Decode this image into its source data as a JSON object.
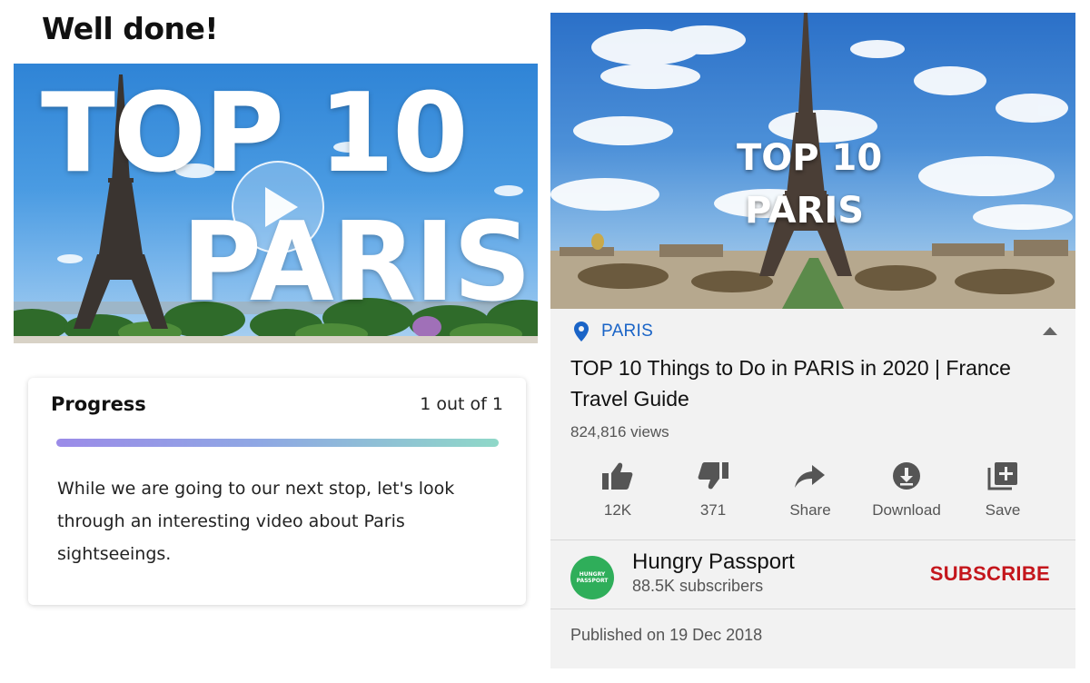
{
  "left": {
    "heading": "Well done!",
    "thumbnail": {
      "line1": "TOP 10",
      "line2": "PARIS",
      "play_icon": "play-icon"
    },
    "progress_card": {
      "title": "Progress",
      "count": "1 out of 1",
      "progress_fraction": 1.0,
      "description": "While we are going to our next stop, let's look through an interesting video about Paris sightseeings."
    }
  },
  "right": {
    "thumbnail": {
      "line1": "TOP 10",
      "line2": "PARIS"
    },
    "location": {
      "icon": "location-pin-icon",
      "label": "PARIS"
    },
    "video_title": "TOP 10 Things to Do in PARIS in 2020 | France Travel Guide",
    "views": "824,816 views",
    "actions": [
      {
        "icon": "thumbs-up-icon",
        "label": "12K"
      },
      {
        "icon": "thumbs-down-icon",
        "label": "371"
      },
      {
        "icon": "share-icon",
        "label": "Share"
      },
      {
        "icon": "download-icon",
        "label": "Download"
      },
      {
        "icon": "save-playlist-icon",
        "label": "Save"
      }
    ],
    "channel": {
      "avatar_text_1": "HUNGRY",
      "avatar_text_2": "PASSPORT",
      "name": "Hungry Passport",
      "subscribers": "88.5K subscribers",
      "subscribe_label": "SUBSCRIBE"
    },
    "published": "Published on 19 Dec 2018"
  },
  "colors": {
    "accent_blue": "#1a64c7",
    "subscribe_red": "#c4161c",
    "avatar_green": "#2fae5a",
    "progress_gradient": [
      "#9b8be8",
      "#8fd8c8"
    ]
  }
}
